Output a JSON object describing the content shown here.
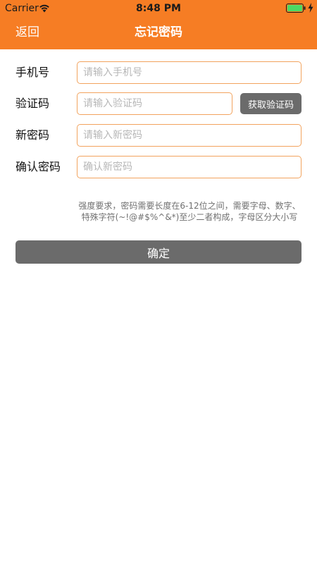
{
  "status_bar": {
    "carrier": "Carrier",
    "time": "8:48 PM",
    "battery_color": "#4cd964"
  },
  "nav": {
    "back_label": "返回",
    "title": "忘记密码",
    "background_color": "#f67d24"
  },
  "form": {
    "phone": {
      "label": "手机号",
      "placeholder": "请输入手机号",
      "value": ""
    },
    "code": {
      "label": "验证码",
      "placeholder": "请输入验证码",
      "value": "",
      "button_label": "获取验证码"
    },
    "new_password": {
      "label": "新密码",
      "placeholder": "请输入新密码",
      "value": ""
    },
    "confirm_password": {
      "label": "确认密码",
      "placeholder": "确认新密码",
      "value": ""
    }
  },
  "hint": "强度要求，密码需要长度在6-12位之间，需要字母、数字、特殊字符(~!@#$%^&*)至少二者构成，字母区分大小写",
  "confirm_label": "确定",
  "icons": {
    "wifi": "wifi-icon",
    "battery": "battery-icon",
    "charging": "bolt-icon"
  }
}
